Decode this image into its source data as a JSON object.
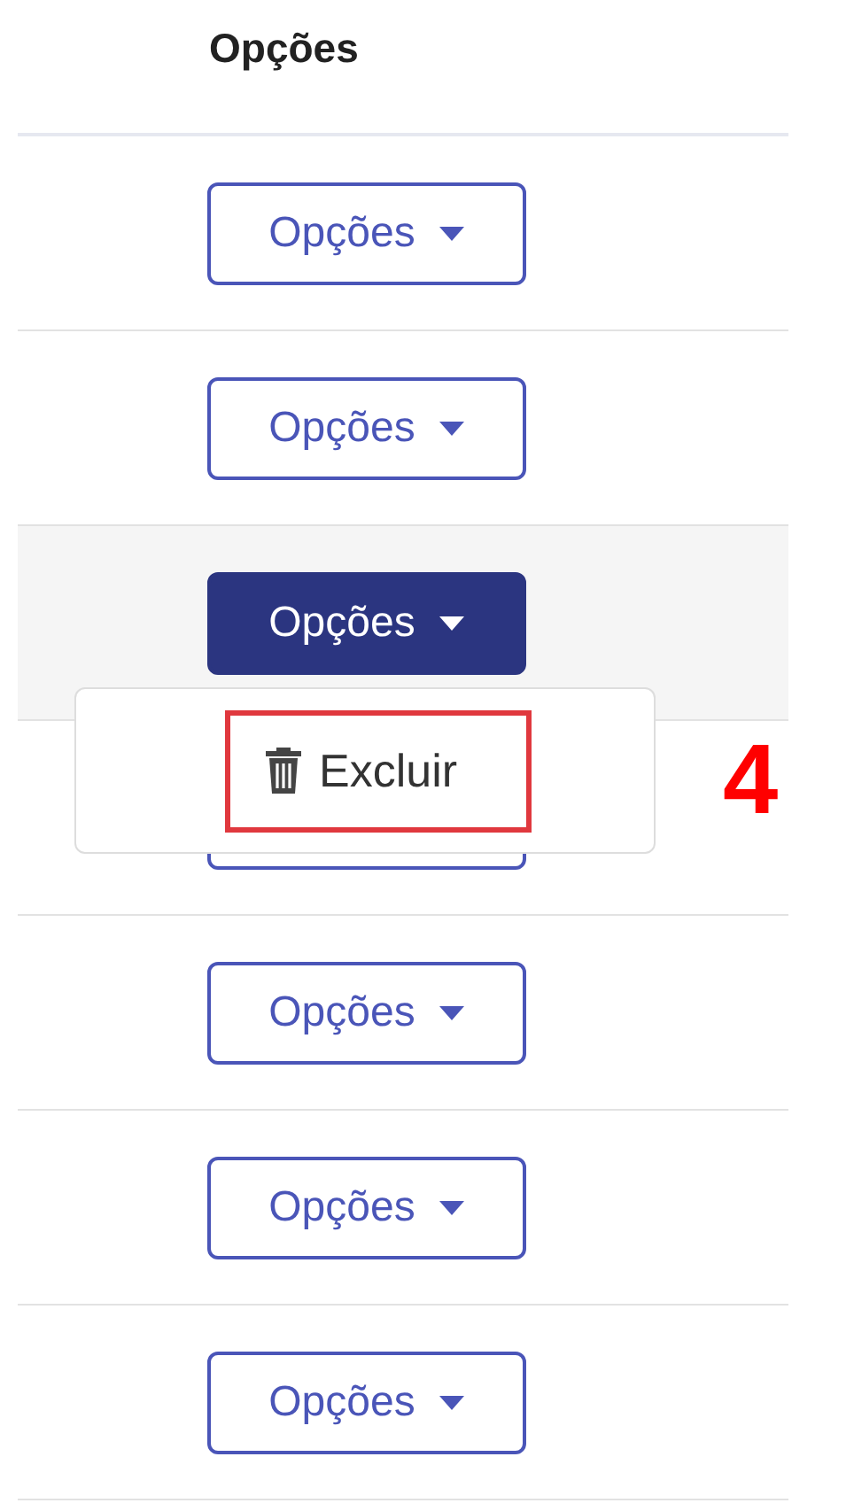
{
  "column_header": "Opções",
  "rows": [
    {
      "button": "Opções",
      "open": false
    },
    {
      "button": "Opções",
      "open": false
    },
    {
      "button": "Opções",
      "open": true
    },
    {
      "open": false
    },
    {
      "button": "Opções",
      "open": false
    },
    {
      "button": "Opções",
      "open": false
    },
    {
      "button": "Opções",
      "open": false
    }
  ],
  "menu": {
    "items": [
      {
        "label": "Excluir",
        "highlighted": true
      }
    ]
  },
  "annotation": "4"
}
